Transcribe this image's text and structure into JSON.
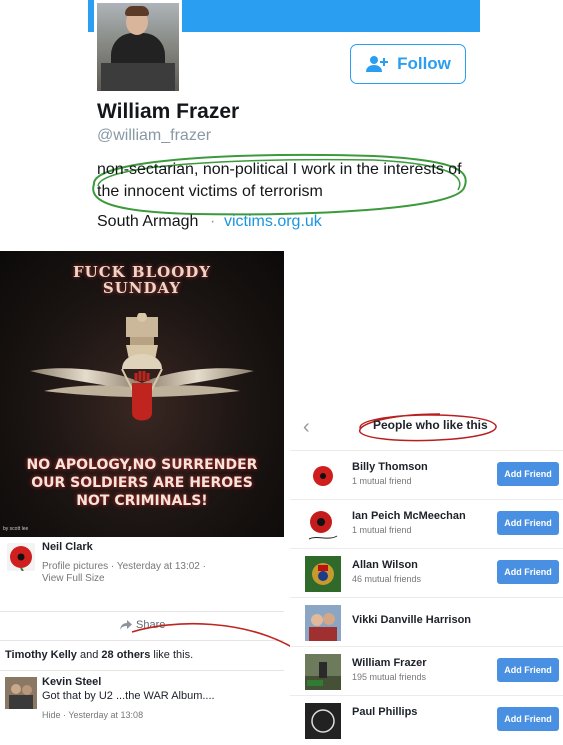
{
  "twitter": {
    "name": "William Frazer",
    "handle": "@william_frazer",
    "bio": "non-sectarian, non-political I work in the interests of the innocent victims of terrorism",
    "location": "South Armagh",
    "separator": "·",
    "link": "victims.org.uk",
    "follow_label": "Follow",
    "accent": "#2a9ff2"
  },
  "post": {
    "image_text": {
      "headline_line1": "FUCK BLOODY",
      "headline_line2": "SUNDAY",
      "slogan_line1": "NO APOLOGY,NO SURRENDER",
      "slogan_line2": "OUR SOLDIERS ARE HEROES",
      "slogan_line3": "NOT CRIMINALS!",
      "credit": "by scott lee"
    },
    "poster_name": "Neil Clark",
    "poster_meta": "Profile pictures · Yesterday at 13:02 ·",
    "view_full_size": "View Full Size",
    "share_label": "Share",
    "likes": {
      "first_name": "Timothy Kelly",
      "and": "and",
      "others": "28 others",
      "suffix": "like this."
    },
    "comment": {
      "name": "Kevin Steel",
      "text": "Got that by U2 ...the WAR Album....",
      "meta": "Hide · Yesterday at 13:08"
    }
  },
  "panel": {
    "back_icon": "chevron-left",
    "title": "People who like this",
    "add_friend_label": "Add Friend",
    "people": [
      {
        "name": "Billy Thomson",
        "mutual": "1 mutual friend",
        "has_add": true
      },
      {
        "name": "Ian Peich McMeechan",
        "mutual": "1 mutual friend",
        "has_add": true
      },
      {
        "name": "Allan Wilson",
        "mutual": "46 mutual friends",
        "has_add": true
      },
      {
        "name": "Vikki Danville Harrison",
        "mutual": "",
        "has_add": false
      },
      {
        "name": "William Frazer",
        "mutual": "195 mutual friends",
        "has_add": true
      },
      {
        "name": "Paul Phillips",
        "mutual": "",
        "has_add": true
      }
    ]
  }
}
